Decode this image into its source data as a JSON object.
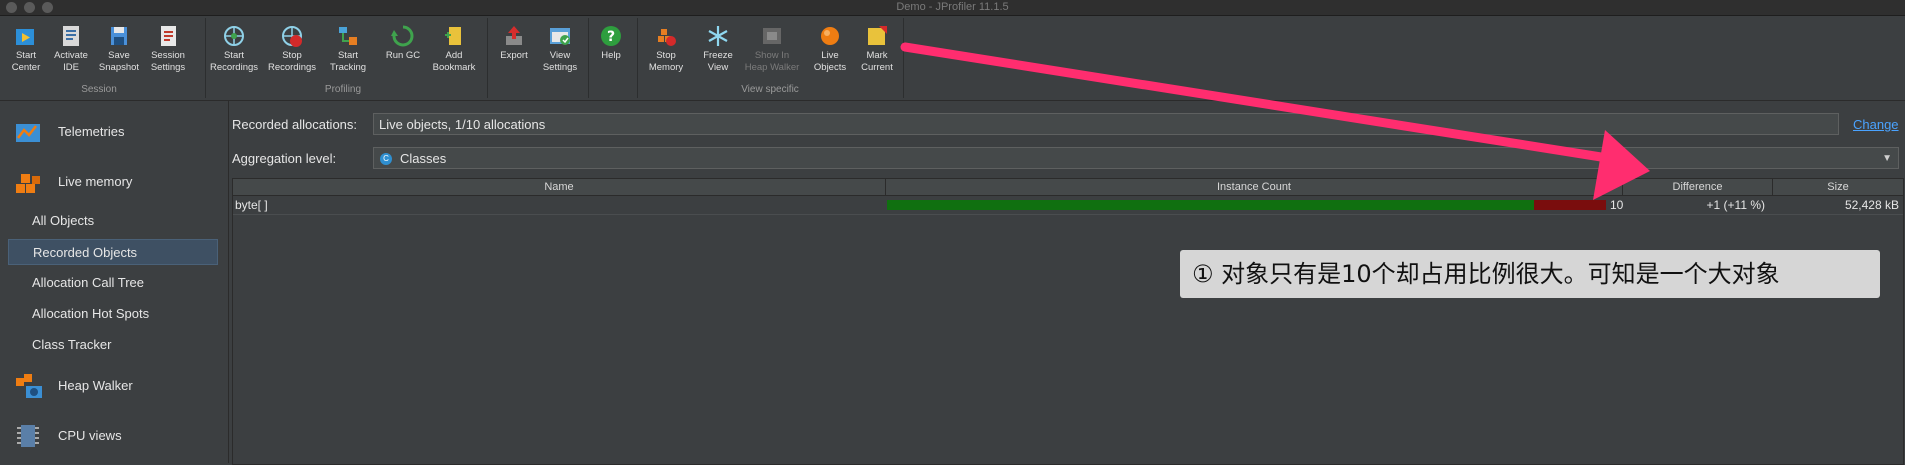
{
  "window": {
    "title": "Demo - JProfiler 11.1.5"
  },
  "toolbar": {
    "buttons": [
      {
        "id": "start-center",
        "label1": "Start",
        "label2": "Center",
        "icon": "start-center-icon"
      },
      {
        "id": "activate-ide",
        "label1": "Activate",
        "label2": "IDE",
        "icon": "ide-icon"
      },
      {
        "id": "save-snapshot",
        "label1": "Save",
        "label2": "Snapshot",
        "icon": "save-icon"
      },
      {
        "id": "session-settings",
        "label1": "Session",
        "label2": "Settings",
        "icon": "settings-doc-icon"
      },
      {
        "id": "start-recordings",
        "label1": "Start",
        "label2": "Recordings",
        "icon": "record-start-icon"
      },
      {
        "id": "stop-recordings",
        "label1": "Stop",
        "label2": "Recordings",
        "icon": "record-stop-icon"
      },
      {
        "id": "start-tracking",
        "label1": "Start",
        "label2": "Tracking",
        "icon": "tracking-icon"
      },
      {
        "id": "run-gc",
        "label1": "Run GC",
        "label2": "",
        "icon": "gc-icon"
      },
      {
        "id": "add-bookmark",
        "label1": "Add",
        "label2": "Bookmark",
        "icon": "bookmark-icon"
      },
      {
        "id": "export",
        "label1": "Export",
        "label2": "",
        "icon": "export-icon"
      },
      {
        "id": "view-settings",
        "label1": "View",
        "label2": "Settings",
        "icon": "view-settings-icon"
      },
      {
        "id": "help",
        "label1": "Help",
        "label2": "",
        "icon": "help-icon"
      },
      {
        "id": "stop-memory",
        "label1": "Stop",
        "label2": "Memory",
        "icon": "stop-memory-icon"
      },
      {
        "id": "freeze-view",
        "label1": "Freeze",
        "label2": "View",
        "icon": "snowflake-icon"
      },
      {
        "id": "show-in-heap-walker",
        "label1": "Show In",
        "label2": "Heap Walker",
        "icon": "heap-walker-icon"
      },
      {
        "id": "live-objects",
        "label1": "Live",
        "label2": "Objects",
        "icon": "live-objects-icon"
      },
      {
        "id": "mark-current",
        "label1": "Mark",
        "label2": "Current",
        "icon": "mark-current-icon"
      }
    ],
    "groups": {
      "session": "Session",
      "profiling": "Profiling",
      "view_specific": "View specific"
    }
  },
  "sidebar": {
    "sections": [
      {
        "label": "Telemetries",
        "icon": "telemetries-icon"
      },
      {
        "label": "Live memory",
        "icon": "live-memory-icon"
      },
      {
        "label": "Heap Walker",
        "icon": "heap-walker-icon"
      },
      {
        "label": "CPU views",
        "icon": "cpu-views-icon"
      }
    ],
    "items": [
      {
        "label": "All Objects"
      },
      {
        "label": "Recorded Objects"
      },
      {
        "label": "Allocation Call Tree"
      },
      {
        "label": "Allocation Hot Spots"
      },
      {
        "label": "Class Tracker"
      }
    ]
  },
  "content": {
    "recorded_allocations_label": "Recorded allocations:",
    "recorded_allocations_value": "Live objects, 1/10 allocations",
    "change_link": "Change",
    "aggregation_label": "Aggregation level:",
    "aggregation_value": "Classes",
    "aggregation_badge": "C"
  },
  "table": {
    "columns": [
      "Name",
      "Instance Count",
      "Difference",
      "Size"
    ],
    "rows": [
      {
        "name": "byte[ ]",
        "instance_count": "10",
        "difference": "+1 (+11 %)",
        "size": "52,428 kB"
      }
    ]
  },
  "annotation": {
    "text": "①  对象只有是10个却占用比例很大。可知是一个大对象"
  },
  "colors": {
    "accent_arrow": "#ff2d6f",
    "bar_green": "#107010",
    "bar_red": "#7a0d0d",
    "link": "#4aa3ff"
  }
}
